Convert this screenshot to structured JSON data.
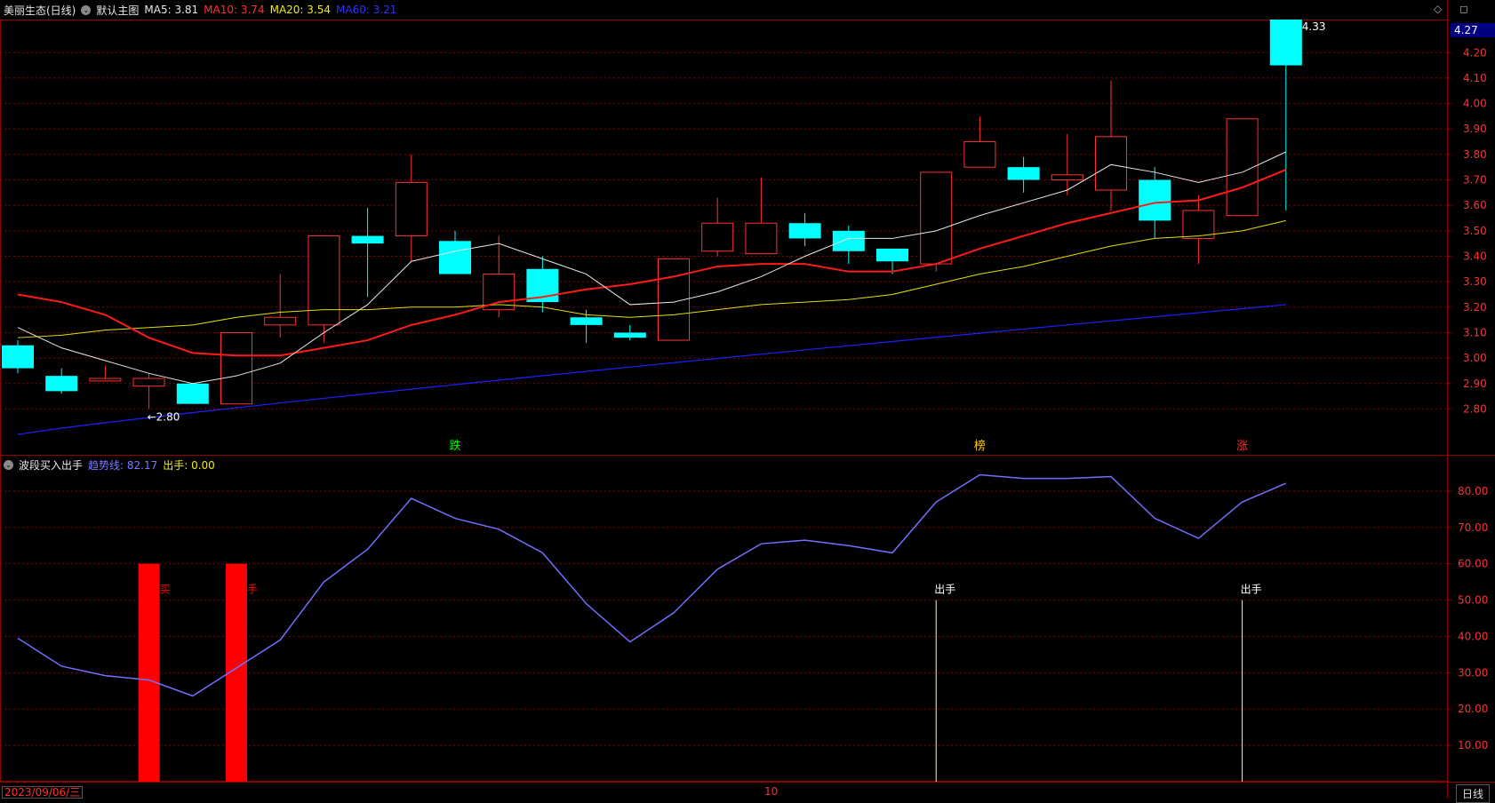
{
  "top_header": {
    "stock_name": "美丽生态(日线)",
    "main_chart_label": "默认主图",
    "ma5": "MA5: 3.81",
    "ma10": "MA10: 3.74",
    "ma20": "MA20: 3.54",
    "ma60": "MA60: 3.21"
  },
  "window_icons": "◇ ◻",
  "current_price_label": "4.27",
  "indicator_header": {
    "name": "波段买入出手",
    "trend": "趋势线: 82.17",
    "action": "出手: 0.00"
  },
  "footer": {
    "date": "2023/09/06/三",
    "month_tick": "10",
    "period": "日线"
  },
  "colors": {
    "up": "#ff3030",
    "down": "#00ffff",
    "ma5": "#e8e8e8",
    "ma10": "#ff1a1a",
    "ma20": "#e0e000",
    "ma60": "#2020ff",
    "trend": "#7070ff",
    "grid": "#8b0000"
  },
  "chart_data": [
    {
      "type": "candlestick",
      "title": "美丽生态(日线)",
      "ylim": [
        2.62,
        4.33
      ],
      "y_ticks": [
        "4.20",
        "4.10",
        "4.00",
        "3.90",
        "3.80",
        "3.70",
        "3.60",
        "3.50",
        "3.40",
        "3.30",
        "3.20",
        "3.10",
        "3.00",
        "2.90",
        "2.80"
      ],
      "candles": [
        {
          "o": 3.05,
          "h": 3.07,
          "l": 2.94,
          "c": 2.96
        },
        {
          "o": 2.93,
          "h": 2.96,
          "l": 2.86,
          "c": 2.87
        },
        {
          "o": 2.91,
          "h": 2.97,
          "l": 2.91,
          "c": 2.92
        },
        {
          "o": 2.89,
          "h": 2.94,
          "l": 2.8,
          "c": 2.92
        },
        {
          "o": 2.9,
          "h": 2.9,
          "l": 2.82,
          "c": 2.82
        },
        {
          "o": 2.82,
          "h": 3.1,
          "l": 2.82,
          "c": 3.1
        },
        {
          "o": 3.13,
          "h": 3.33,
          "l": 3.08,
          "c": 3.16
        },
        {
          "o": 3.13,
          "h": 3.48,
          "l": 3.06,
          "c": 3.48
        },
        {
          "o": 3.48,
          "h": 3.59,
          "l": 3.24,
          "c": 3.45
        },
        {
          "o": 3.48,
          "h": 3.8,
          "l": 3.38,
          "c": 3.69
        },
        {
          "o": 3.46,
          "h": 3.5,
          "l": 3.33,
          "c": 3.33
        },
        {
          "o": 3.19,
          "h": 3.48,
          "l": 3.16,
          "c": 3.33
        },
        {
          "o": 3.35,
          "h": 3.4,
          "l": 3.18,
          "c": 3.22
        },
        {
          "o": 3.16,
          "h": 3.19,
          "l": 3.06,
          "c": 3.13
        },
        {
          "o": 3.1,
          "h": 3.13,
          "l": 3.07,
          "c": 3.08
        },
        {
          "o": 3.07,
          "h": 3.39,
          "l": 3.07,
          "c": 3.39
        },
        {
          "o": 3.42,
          "h": 3.63,
          "l": 3.4,
          "c": 3.53
        },
        {
          "o": 3.41,
          "h": 3.71,
          "l": 3.41,
          "c": 3.53
        },
        {
          "o": 3.53,
          "h": 3.57,
          "l": 3.44,
          "c": 3.47
        },
        {
          "o": 3.5,
          "h": 3.52,
          "l": 3.37,
          "c": 3.42
        },
        {
          "o": 3.43,
          "h": 3.43,
          "l": 3.33,
          "c": 3.38
        },
        {
          "o": 3.37,
          "h": 3.73,
          "l": 3.34,
          "c": 3.73
        },
        {
          "o": 3.75,
          "h": 3.95,
          "l": 3.75,
          "c": 3.85
        },
        {
          "o": 3.75,
          "h": 3.79,
          "l": 3.65,
          "c": 3.7
        },
        {
          "o": 3.7,
          "h": 3.88,
          "l": 3.64,
          "c": 3.72
        },
        {
          "o": 3.66,
          "h": 4.09,
          "l": 3.58,
          "c": 3.87
        },
        {
          "o": 3.7,
          "h": 3.75,
          "l": 3.47,
          "c": 3.54
        },
        {
          "o": 3.47,
          "h": 3.64,
          "l": 3.37,
          "c": 3.58
        },
        {
          "o": 3.56,
          "h": 3.94,
          "l": 3.56,
          "c": 3.94
        },
        {
          "o": 4.33,
          "h": 4.33,
          "l": 3.58,
          "c": 4.15
        }
      ],
      "ma5": [
        3.12,
        3.04,
        2.99,
        2.94,
        2.9,
        2.93,
        2.98,
        3.1,
        3.21,
        3.38,
        3.42,
        3.45,
        3.39,
        3.33,
        3.21,
        3.22,
        3.26,
        3.32,
        3.4,
        3.47,
        3.47,
        3.5,
        3.56,
        3.61,
        3.66,
        3.76,
        3.73,
        3.69,
        3.73,
        3.81
      ],
      "ma10": [
        3.25,
        3.22,
        3.17,
        3.08,
        3.02,
        3.01,
        3.01,
        3.04,
        3.07,
        3.13,
        3.17,
        3.22,
        3.24,
        3.27,
        3.29,
        3.32,
        3.36,
        3.37,
        3.37,
        3.34,
        3.34,
        3.37,
        3.43,
        3.48,
        3.53,
        3.57,
        3.61,
        3.62,
        3.67,
        3.74
      ],
      "ma20": [
        3.08,
        3.09,
        3.11,
        3.12,
        3.13,
        3.16,
        3.18,
        3.19,
        3.19,
        3.2,
        3.2,
        3.21,
        3.2,
        3.17,
        3.16,
        3.17,
        3.19,
        3.21,
        3.22,
        3.23,
        3.25,
        3.29,
        3.33,
        3.36,
        3.4,
        3.44,
        3.47,
        3.48,
        3.5,
        3.54
      ],
      "ma60_start": 2.7,
      "ma60_end": 3.21,
      "annotations": [
        {
          "type": "low",
          "index": 3,
          "label": "←2.80"
        },
        {
          "type": "high",
          "index": 29,
          "label": "4.33"
        },
        {
          "type": "marker",
          "index": 10,
          "label": "跌",
          "color": "#00ff00"
        },
        {
          "type": "marker",
          "index": 22,
          "label": "榜",
          "color": "#ffcc00"
        },
        {
          "type": "marker",
          "index": 28,
          "label": "涨",
          "color": "#ff3030"
        }
      ]
    },
    {
      "type": "line",
      "title": "波段买入出手",
      "ylim": [
        0,
        90
      ],
      "y_ticks": [
        "80.00",
        "70.00",
        "60.00",
        "50.00",
        "40.00",
        "30.00",
        "20.00",
        "10.00"
      ],
      "series": [
        {
          "name": "趋势线",
          "values": [
            39.5,
            31.8,
            29.2,
            28.0,
            23.6,
            31.3,
            39.0,
            55.0,
            64.0,
            78.0,
            72.5,
            69.5,
            63.0,
            49.0,
            38.5,
            46.5,
            58.5,
            65.5,
            66.5,
            65.0,
            63.0,
            77.0,
            84.5,
            83.5,
            83.5,
            84.0,
            72.5,
            67.0,
            77.0,
            82.17
          ]
        }
      ],
      "bars": [
        {
          "index": 3,
          "value": 60,
          "label": "买",
          "color": "#ff0000"
        },
        {
          "index": 5,
          "value": 60,
          "label": "手",
          "color": "#ff0000"
        }
      ],
      "signals": [
        {
          "index": 21,
          "value": 50,
          "label": "出手"
        },
        {
          "index": 28,
          "value": 50,
          "label": "出手"
        }
      ]
    }
  ]
}
